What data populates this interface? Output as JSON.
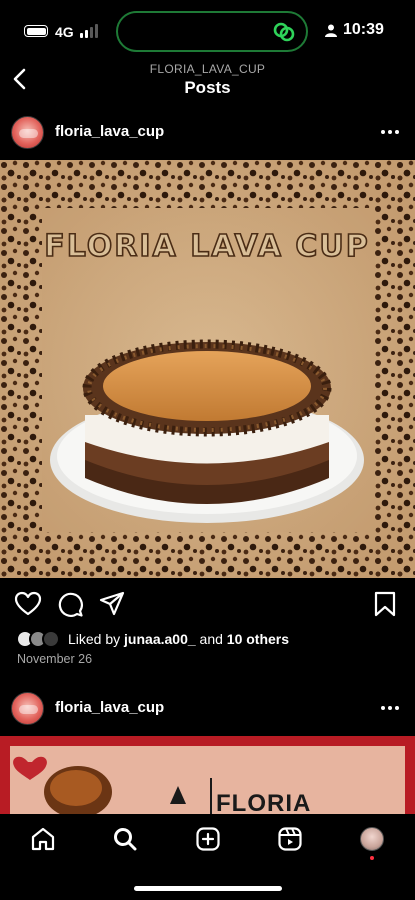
{
  "status_bar": {
    "network": "4G",
    "time": "10:39",
    "island_icon": "link-icon"
  },
  "header": {
    "account": "FLORIA_LAVA_CUP",
    "title": "Posts",
    "back_icon": "chevron-left-icon"
  },
  "posts": [
    {
      "username": "floria_lava_cup",
      "image_text": "FLORIA LAVA CUP",
      "liked_by_prefix": "Liked by",
      "liked_by_user": "junaa.a00_",
      "liked_by_and": "and",
      "liked_by_others": "10 others",
      "date": "November 26"
    },
    {
      "username": "floria_lava_cup",
      "image_text": "FLORIA"
    }
  ],
  "actions": {
    "like_icon": "heart-icon",
    "comment_icon": "comment-icon",
    "share_icon": "send-icon",
    "save_icon": "bookmark-icon"
  },
  "bottom_nav": [
    "home-icon",
    "search-icon",
    "create-icon",
    "reels-icon",
    "profile-avatar"
  ],
  "colors": {
    "background": "#000000",
    "island_border": "#1e7a36",
    "muted_text": "#a8a8a8",
    "notification_dot": "#ff3040",
    "post2_frame": "#b81c24"
  }
}
